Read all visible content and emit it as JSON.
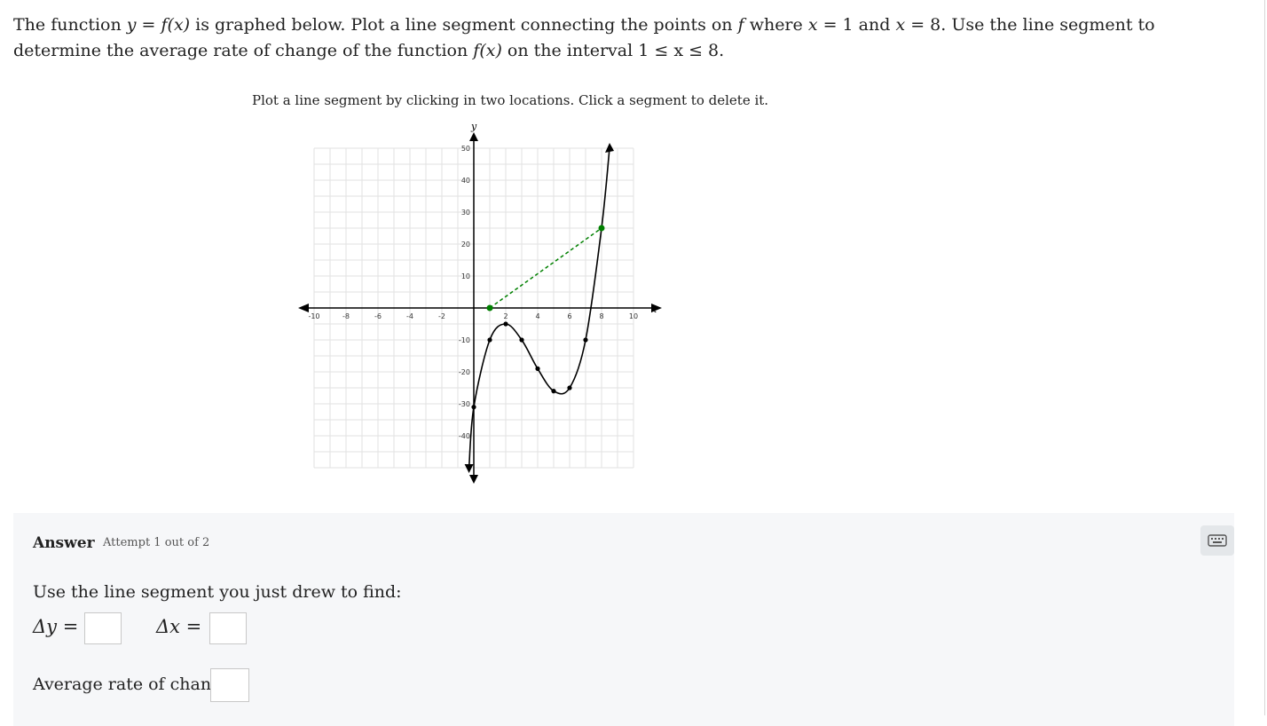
{
  "question": {
    "part1": "The function",
    "y": "y",
    "eq": " = ",
    "fx": "f(x)",
    "part2": "is graphed below. Plot a line segment connecting the points on",
    "f": "f",
    "part3": "where",
    "x1": "x",
    "eq1": " = 1",
    "and": "and",
    "x2": "x",
    "eq2": " = 8",
    "part4": ". Use the line segment to determine the average rate of change of the function",
    "fx2": "f(x)",
    "part5": "on the interval",
    "interval": "1 ≤ x ≤ 8",
    "end": "."
  },
  "instructions": "Plot a line segment by clicking in two locations. Click a segment to delete it.",
  "graph": {
    "x_axis_label": "x",
    "y_axis_label": "y",
    "x_ticks": [
      -10,
      -8,
      -6,
      -4,
      -2,
      2,
      4,
      6,
      8,
      10
    ],
    "y_ticks": [
      50,
      40,
      30,
      20,
      10,
      -10,
      -20,
      -30,
      -40
    ],
    "x_range": [
      -10,
      10
    ],
    "y_range": [
      -50,
      50
    ],
    "grid_color": "#e2e2e2",
    "curve_color": "#000000",
    "segment_color": "#008000",
    "curve_points": [
      [
        0,
        -31
      ],
      [
        1,
        -10
      ],
      [
        2,
        -5
      ],
      [
        3,
        -10
      ],
      [
        4,
        -19
      ],
      [
        5,
        -26
      ],
      [
        6,
        -25
      ],
      [
        7,
        -10
      ],
      [
        8,
        25
      ]
    ],
    "segment": [
      [
        1,
        0
      ],
      [
        8,
        25
      ]
    ]
  },
  "answer": {
    "title": "Answer",
    "attempt": "Attempt 1 out of 2",
    "keyboard_icon": "keyboard-icon",
    "prompt": "Use the line segment you just drew to find:",
    "dy_label": "Δy =",
    "dx_label": "Δx =",
    "avg_label": "Average rate of change:",
    "dy_value": "",
    "dx_value": "",
    "avg_value": ""
  }
}
